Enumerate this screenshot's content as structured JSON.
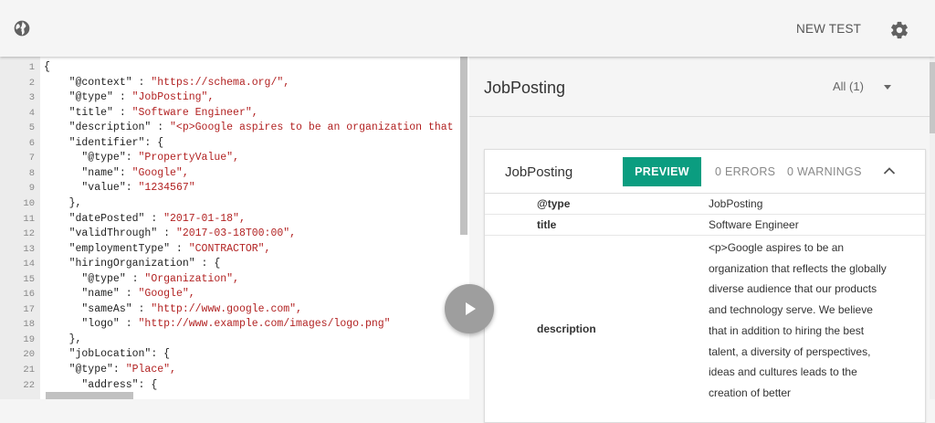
{
  "header": {
    "globe_icon": "globe-icon",
    "new_test_label": "NEW TEST",
    "settings_icon": "gear-icon"
  },
  "editor": {
    "lines": [
      {
        "n": "1",
        "key": "{",
        "val": ""
      },
      {
        "n": "2",
        "key": "    \"@context\" : ",
        "val": "\"https://schema.org/\","
      },
      {
        "n": "3",
        "key": "    \"@type\" : ",
        "val": "\"JobPosting\","
      },
      {
        "n": "4",
        "key": "    \"title\" : ",
        "val": "\"Software Engineer\","
      },
      {
        "n": "5",
        "key": "    \"description\" : ",
        "val": "\"<p>Google aspires to be an organization that r"
      },
      {
        "n": "6",
        "key": "    \"identifier\": {",
        "val": ""
      },
      {
        "n": "7",
        "key": "      \"@type\": ",
        "val": "\"PropertyValue\","
      },
      {
        "n": "8",
        "key": "      \"name\": ",
        "val": "\"Google\","
      },
      {
        "n": "9",
        "key": "      \"value\": ",
        "val": "\"1234567\""
      },
      {
        "n": "10",
        "key": "    },",
        "val": ""
      },
      {
        "n": "11",
        "key": "    \"datePosted\" : ",
        "val": "\"2017-01-18\","
      },
      {
        "n": "12",
        "key": "    \"validThrough\" : ",
        "val": "\"2017-03-18T00:00\","
      },
      {
        "n": "13",
        "key": "    \"employmentType\" : ",
        "val": "\"CONTRACTOR\","
      },
      {
        "n": "14",
        "key": "    \"hiringOrganization\" : {",
        "val": ""
      },
      {
        "n": "15",
        "key": "      \"@type\" : ",
        "val": "\"Organization\","
      },
      {
        "n": "16",
        "key": "      \"name\" : ",
        "val": "\"Google\","
      },
      {
        "n": "17",
        "key": "      \"sameAs\" : ",
        "val": "\"http://www.google.com\","
      },
      {
        "n": "18",
        "key": "      \"logo\" : ",
        "val": "\"http://www.example.com/images/logo.png\""
      },
      {
        "n": "19",
        "key": "    },",
        "val": ""
      },
      {
        "n": "20",
        "key": "    \"jobLocation\": {",
        "val": ""
      },
      {
        "n": "21",
        "key": "    \"@type\": ",
        "val": "\"Place\","
      },
      {
        "n": "22",
        "key": "      \"address\": {",
        "val": ""
      }
    ]
  },
  "run_button_icon": "play-icon",
  "results": {
    "title": "JobPosting",
    "filter_label": "All (1)",
    "card": {
      "title": "JobPosting",
      "preview_label": "PREVIEW",
      "errors_label": "0 ERRORS",
      "warnings_label": "0 WARNINGS",
      "rows": [
        {
          "prop": "@type",
          "value": "JobPosting"
        },
        {
          "prop": "title",
          "value": "Software Engineer"
        },
        {
          "prop": "description",
          "value": "<p>Google aspires to be an organization that reflects the globally diverse audience that our products and technology serve. We believe that in addition to hiring the best talent, a diversity of perspectives, ideas and cultures leads to the creation of better"
        }
      ]
    }
  }
}
